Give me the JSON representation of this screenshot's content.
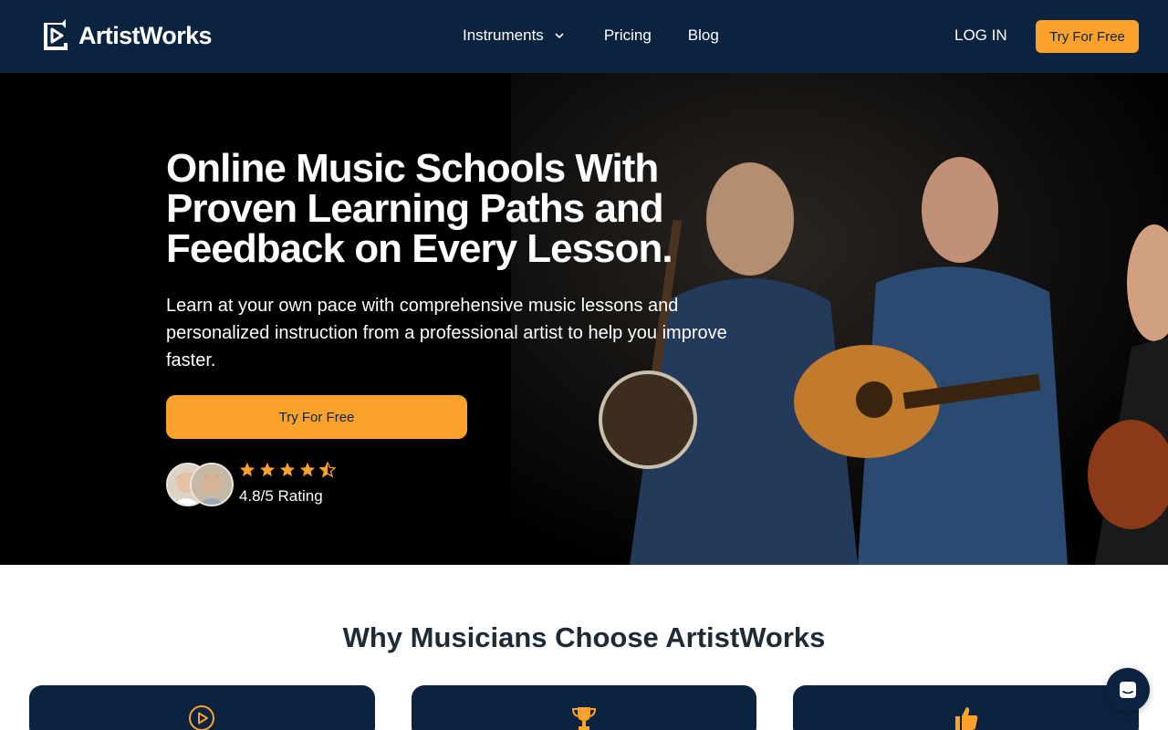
{
  "header": {
    "brand": "ArtistWorks",
    "nav": [
      {
        "label": "Instruments",
        "has_dropdown": true
      },
      {
        "label": "Pricing"
      },
      {
        "label": "Blog"
      }
    ],
    "login_label": "LOG IN",
    "cta_label": "Try For Free"
  },
  "hero": {
    "title": "Online Music Schools With Proven Learning Paths and Feedback on Every Lesson.",
    "subtitle": "Learn at your own pace with comprehensive music lessons and personalized instruction from a professional artist to help you improve faster.",
    "cta_label": "Try For Free",
    "rating_stars": 4.5,
    "rating_text": "4.8/5 Rating"
  },
  "why": {
    "title": "Why Musicians Choose ArtistWorks",
    "cards": [
      {
        "icon": "play-circle-icon"
      },
      {
        "icon": "trophy-icon"
      },
      {
        "icon": "thumbs-up-icon"
      }
    ]
  },
  "colors": {
    "navy": "#0c2340",
    "orange": "#fba22d",
    "black": "#000000"
  }
}
